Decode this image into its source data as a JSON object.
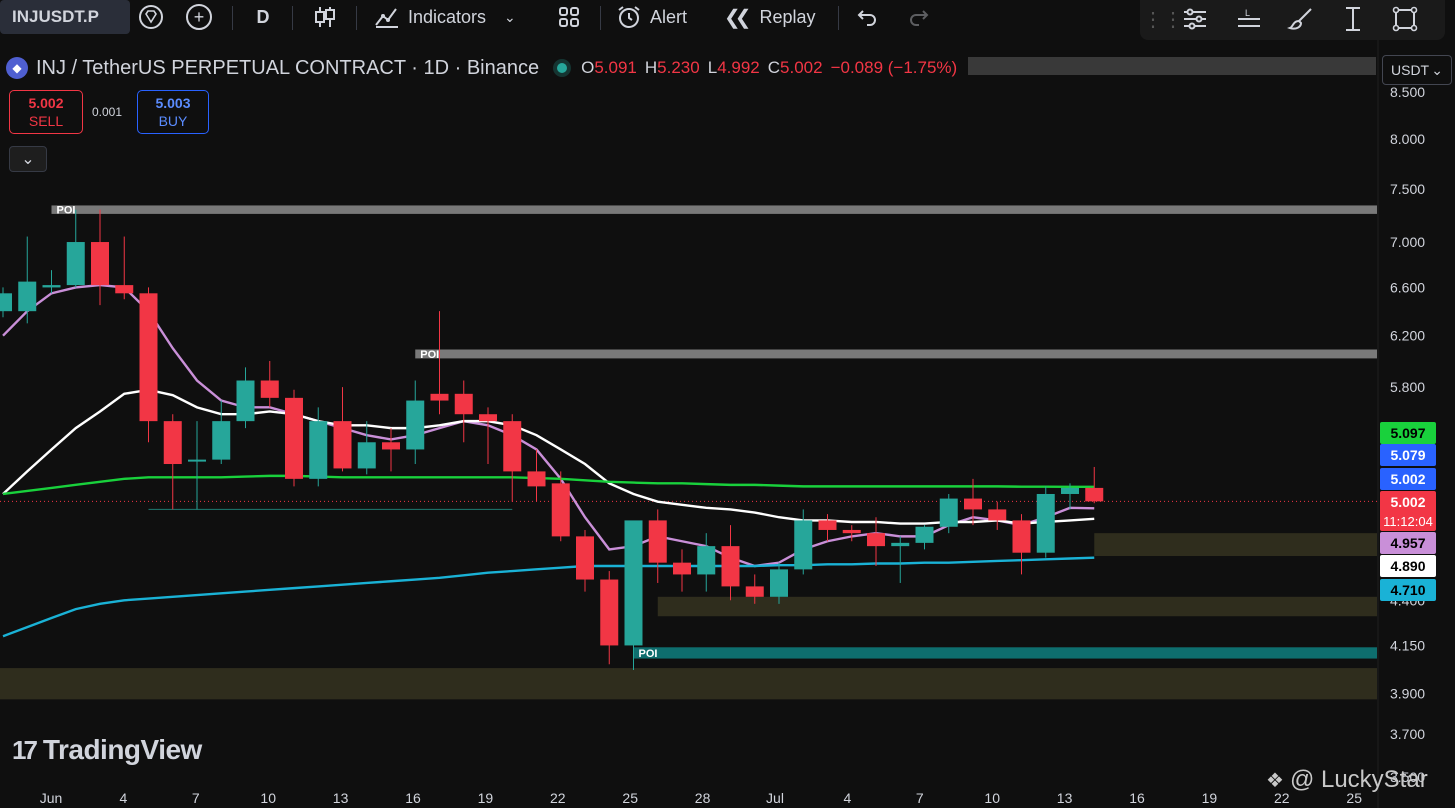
{
  "toolbar": {
    "symbol": "INJUSDT.P",
    "interval": "D",
    "indicators_label": "Indicators",
    "alert_label": "Alert",
    "replay_label": "Replay"
  },
  "legend": {
    "title": "INJ / TetherUS PERPETUAL CONTRACT · 1D · Binance",
    "o_key": "O",
    "o_val": "5.091",
    "h_key": "H",
    "h_val": "5.230",
    "l_key": "L",
    "l_val": "4.992",
    "c_key": "C",
    "c_val": "5.002",
    "change": "−0.089 (−1.75%)"
  },
  "currency": "USDT",
  "trade": {
    "sell_price": "5.002",
    "sell_label": "SELL",
    "buy_price": "5.003",
    "buy_label": "BUY",
    "spread": "0.001"
  },
  "watermark": "TradingView",
  "corner_text": "@ LuckyStar",
  "colors": {
    "up": "#26a69a",
    "down": "#f23645",
    "ma_fast": "#c98fd8",
    "ma_mid": "#ffffff",
    "ma_slow": "#19d13c",
    "ma_long": "#1ab2d6"
  },
  "chart_data": {
    "type": "candlestick",
    "x_ticks": [
      "Jun",
      "4",
      "7",
      "10",
      "13",
      "16",
      "19",
      "22",
      "25",
      "28",
      "Jul",
      "4",
      "7",
      "10",
      "13",
      "16",
      "19",
      "22",
      "25"
    ],
    "y_ticks": [
      "8.500",
      "8.000",
      "7.500",
      "7.000",
      "6.600",
      "6.200",
      "5.800",
      "4.400",
      "4.150",
      "3.900",
      "3.700",
      "3.500"
    ],
    "yscale": "log",
    "ylim": [
      3.5,
      8.6
    ],
    "candles": [
      {
        "o": 6.4,
        "h": 6.6,
        "l": 6.35,
        "c": 6.55
      },
      {
        "o": 6.4,
        "h": 7.05,
        "l": 6.3,
        "c": 6.65
      },
      {
        "o": 6.6,
        "h": 6.75,
        "l": 6.55,
        "c": 6.62
      },
      {
        "o": 6.62,
        "h": 7.3,
        "l": 6.6,
        "c": 7.0
      },
      {
        "o": 7.0,
        "h": 7.3,
        "l": 6.45,
        "c": 6.62
      },
      {
        "o": 6.62,
        "h": 7.05,
        "l": 6.5,
        "c": 6.55
      },
      {
        "o": 6.55,
        "h": 6.6,
        "l": 5.4,
        "c": 5.55
      },
      {
        "o": 5.55,
        "h": 5.6,
        "l": 4.95,
        "c": 5.25
      },
      {
        "o": 5.28,
        "h": 5.55,
        "l": 4.95,
        "c": 5.28
      },
      {
        "o": 5.28,
        "h": 5.7,
        "l": 5.25,
        "c": 5.55
      },
      {
        "o": 5.55,
        "h": 5.95,
        "l": 5.5,
        "c": 5.85
      },
      {
        "o": 5.85,
        "h": 6.0,
        "l": 5.65,
        "c": 5.72
      },
      {
        "o": 5.72,
        "h": 5.78,
        "l": 5.1,
        "c": 5.15
      },
      {
        "o": 5.15,
        "h": 5.65,
        "l": 5.1,
        "c": 5.55
      },
      {
        "o": 5.55,
        "h": 5.8,
        "l": 5.2,
        "c": 5.22
      },
      {
        "o": 5.22,
        "h": 5.55,
        "l": 5.18,
        "c": 5.4
      },
      {
        "o": 5.4,
        "h": 5.5,
        "l": 5.2,
        "c": 5.35
      },
      {
        "o": 5.35,
        "h": 5.85,
        "l": 5.25,
        "c": 5.7
      },
      {
        "o": 5.75,
        "h": 6.4,
        "l": 5.6,
        "c": 5.7
      },
      {
        "o": 5.75,
        "h": 5.85,
        "l": 5.4,
        "c": 5.6
      },
      {
        "o": 5.6,
        "h": 5.65,
        "l": 5.25,
        "c": 5.55
      },
      {
        "o": 5.55,
        "h": 5.6,
        "l": 5.0,
        "c": 5.2
      },
      {
        "o": 5.2,
        "h": 5.35,
        "l": 5.0,
        "c": 5.1
      },
      {
        "o": 5.12,
        "h": 5.2,
        "l": 4.75,
        "c": 4.78
      },
      {
        "o": 4.78,
        "h": 4.82,
        "l": 4.45,
        "c": 4.52
      },
      {
        "o": 4.52,
        "h": 4.57,
        "l": 4.05,
        "c": 4.15
      },
      {
        "o": 4.15,
        "h": 4.35,
        "l": 4.02,
        "c": 4.88
      },
      {
        "o": 4.88,
        "h": 4.95,
        "l": 4.5,
        "c": 4.62
      },
      {
        "o": 4.62,
        "h": 4.7,
        "l": 4.45,
        "c": 4.55
      },
      {
        "o": 4.55,
        "h": 4.8,
        "l": 4.45,
        "c": 4.72
      },
      {
        "o": 4.72,
        "h": 4.85,
        "l": 4.4,
        "c": 4.48
      },
      {
        "o": 4.48,
        "h": 4.55,
        "l": 4.38,
        "c": 4.42
      },
      {
        "o": 4.42,
        "h": 4.62,
        "l": 4.38,
        "c": 4.58
      },
      {
        "o": 4.58,
        "h": 4.95,
        "l": 4.55,
        "c": 4.88
      },
      {
        "o": 4.88,
        "h": 4.92,
        "l": 4.75,
        "c": 4.82
      },
      {
        "o": 4.82,
        "h": 4.85,
        "l": 4.75,
        "c": 4.8
      },
      {
        "o": 4.8,
        "h": 4.9,
        "l": 4.6,
        "c": 4.72
      },
      {
        "o": 4.72,
        "h": 4.78,
        "l": 4.5,
        "c": 4.74
      },
      {
        "o": 4.74,
        "h": 4.85,
        "l": 4.7,
        "c": 4.84
      },
      {
        "o": 4.84,
        "h": 5.05,
        "l": 4.8,
        "c": 5.02
      },
      {
        "o": 5.02,
        "h": 5.15,
        "l": 4.85,
        "c": 4.95
      },
      {
        "o": 4.95,
        "h": 5.0,
        "l": 4.82,
        "c": 4.88
      },
      {
        "o": 4.88,
        "h": 4.92,
        "l": 4.55,
        "c": 4.68
      },
      {
        "o": 4.68,
        "h": 5.1,
        "l": 4.65,
        "c": 5.05
      },
      {
        "o": 5.05,
        "h": 5.12,
        "l": 4.95,
        "c": 5.09
      },
      {
        "o": 5.09,
        "h": 5.23,
        "l": 4.99,
        "c": 5.002
      }
    ],
    "moving_averages": [
      {
        "color": "#c98fd8",
        "values": [
          6.2,
          6.4,
          6.55,
          6.6,
          6.62,
          6.6,
          6.4,
          6.1,
          5.85,
          5.7,
          5.65,
          5.65,
          5.6,
          5.55,
          5.5,
          5.45,
          5.42,
          5.45,
          5.5,
          5.55,
          5.52,
          5.45,
          5.35,
          5.15,
          4.9,
          4.7,
          4.72,
          4.78,
          4.75,
          4.72,
          4.65,
          4.6,
          4.62,
          4.7,
          4.75,
          4.78,
          4.8,
          4.78,
          4.78,
          4.85,
          4.9,
          4.88,
          4.85,
          4.9,
          4.96,
          4.957
        ]
      },
      {
        "color": "#ffffff",
        "values": [
          5.05,
          5.2,
          5.35,
          5.5,
          5.62,
          5.75,
          5.78,
          5.74,
          5.65,
          5.6,
          5.6,
          5.62,
          5.6,
          5.55,
          5.52,
          5.52,
          5.5,
          5.5,
          5.52,
          5.55,
          5.55,
          5.52,
          5.45,
          5.35,
          5.25,
          5.12,
          5.05,
          5.0,
          4.98,
          4.96,
          4.95,
          4.93,
          4.9,
          4.88,
          4.88,
          4.87,
          4.87,
          4.86,
          4.86,
          4.87,
          4.87,
          4.88,
          4.86,
          4.87,
          4.88,
          4.89
        ]
      },
      {
        "color": "#19d13c",
        "values": [
          5.05,
          5.07,
          5.09,
          5.11,
          5.13,
          5.15,
          5.16,
          5.16,
          5.16,
          5.16,
          5.165,
          5.17,
          5.17,
          5.165,
          5.16,
          5.16,
          5.16,
          5.16,
          5.16,
          5.16,
          5.16,
          5.16,
          5.155,
          5.15,
          5.14,
          5.13,
          5.125,
          5.12,
          5.12,
          5.115,
          5.11,
          5.11,
          5.105,
          5.1,
          5.1,
          5.1,
          5.1,
          5.1,
          5.1,
          5.1,
          5.1,
          5.1,
          5.098,
          5.098,
          5.097,
          5.097
        ]
      },
      {
        "color": "#1ab2d6",
        "values": [
          4.2,
          4.25,
          4.3,
          4.35,
          4.38,
          4.4,
          4.41,
          4.42,
          4.43,
          4.44,
          4.45,
          4.46,
          4.47,
          4.48,
          4.49,
          4.5,
          4.51,
          4.52,
          4.53,
          4.545,
          4.56,
          4.57,
          4.58,
          4.59,
          4.6,
          4.6,
          4.6,
          4.6,
          4.6,
          4.6,
          4.6,
          4.6,
          4.605,
          4.605,
          4.61,
          4.61,
          4.615,
          4.615,
          4.62,
          4.62,
          4.625,
          4.63,
          4.635,
          4.64,
          4.645,
          4.65
        ]
      }
    ],
    "zones": [
      {
        "label": "POI",
        "from": 7.26,
        "to": 7.34,
        "start_bar": 2,
        "color": "#9e9e9e"
      },
      {
        "label": "POI",
        "from": 6.02,
        "to": 6.09,
        "start_bar": 17,
        "color": "#9e9e9e"
      },
      {
        "label": "POI",
        "from": 4.08,
        "to": 4.14,
        "start_bar": 26,
        "color": "#0f8f8f"
      },
      {
        "label": "",
        "from": 4.66,
        "to": 4.8,
        "start_bar": 45,
        "color": "#57522f"
      },
      {
        "label": "",
        "from": 4.31,
        "to": 4.42,
        "start_bar": 27,
        "color": "#57522f"
      },
      {
        "label": "",
        "from": 3.87,
        "to": 4.03,
        "start_bar": 0,
        "color": "#57522f"
      }
    ],
    "price_labels": [
      {
        "value": "5.097",
        "bg": "#19d13c",
        "fg": "#000000"
      },
      {
        "value": "5.079",
        "bg": "#2962ff",
        "fg": "#ffffff"
      },
      {
        "value": "5.002",
        "bg": "#2962ff",
        "fg": "#ffffff"
      },
      {
        "value": "5.002",
        "bg": "#f23645",
        "fg": "#ffffff",
        "sub": "11:12:04"
      },
      {
        "value": "4.957",
        "bg": "#c98fd8",
        "fg": "#000000"
      },
      {
        "value": "4.890",
        "bg": "#ffffff",
        "fg": "#000000"
      },
      {
        "value": "4.710",
        "bg": "#1ab2d6",
        "fg": "#000000"
      }
    ]
  }
}
